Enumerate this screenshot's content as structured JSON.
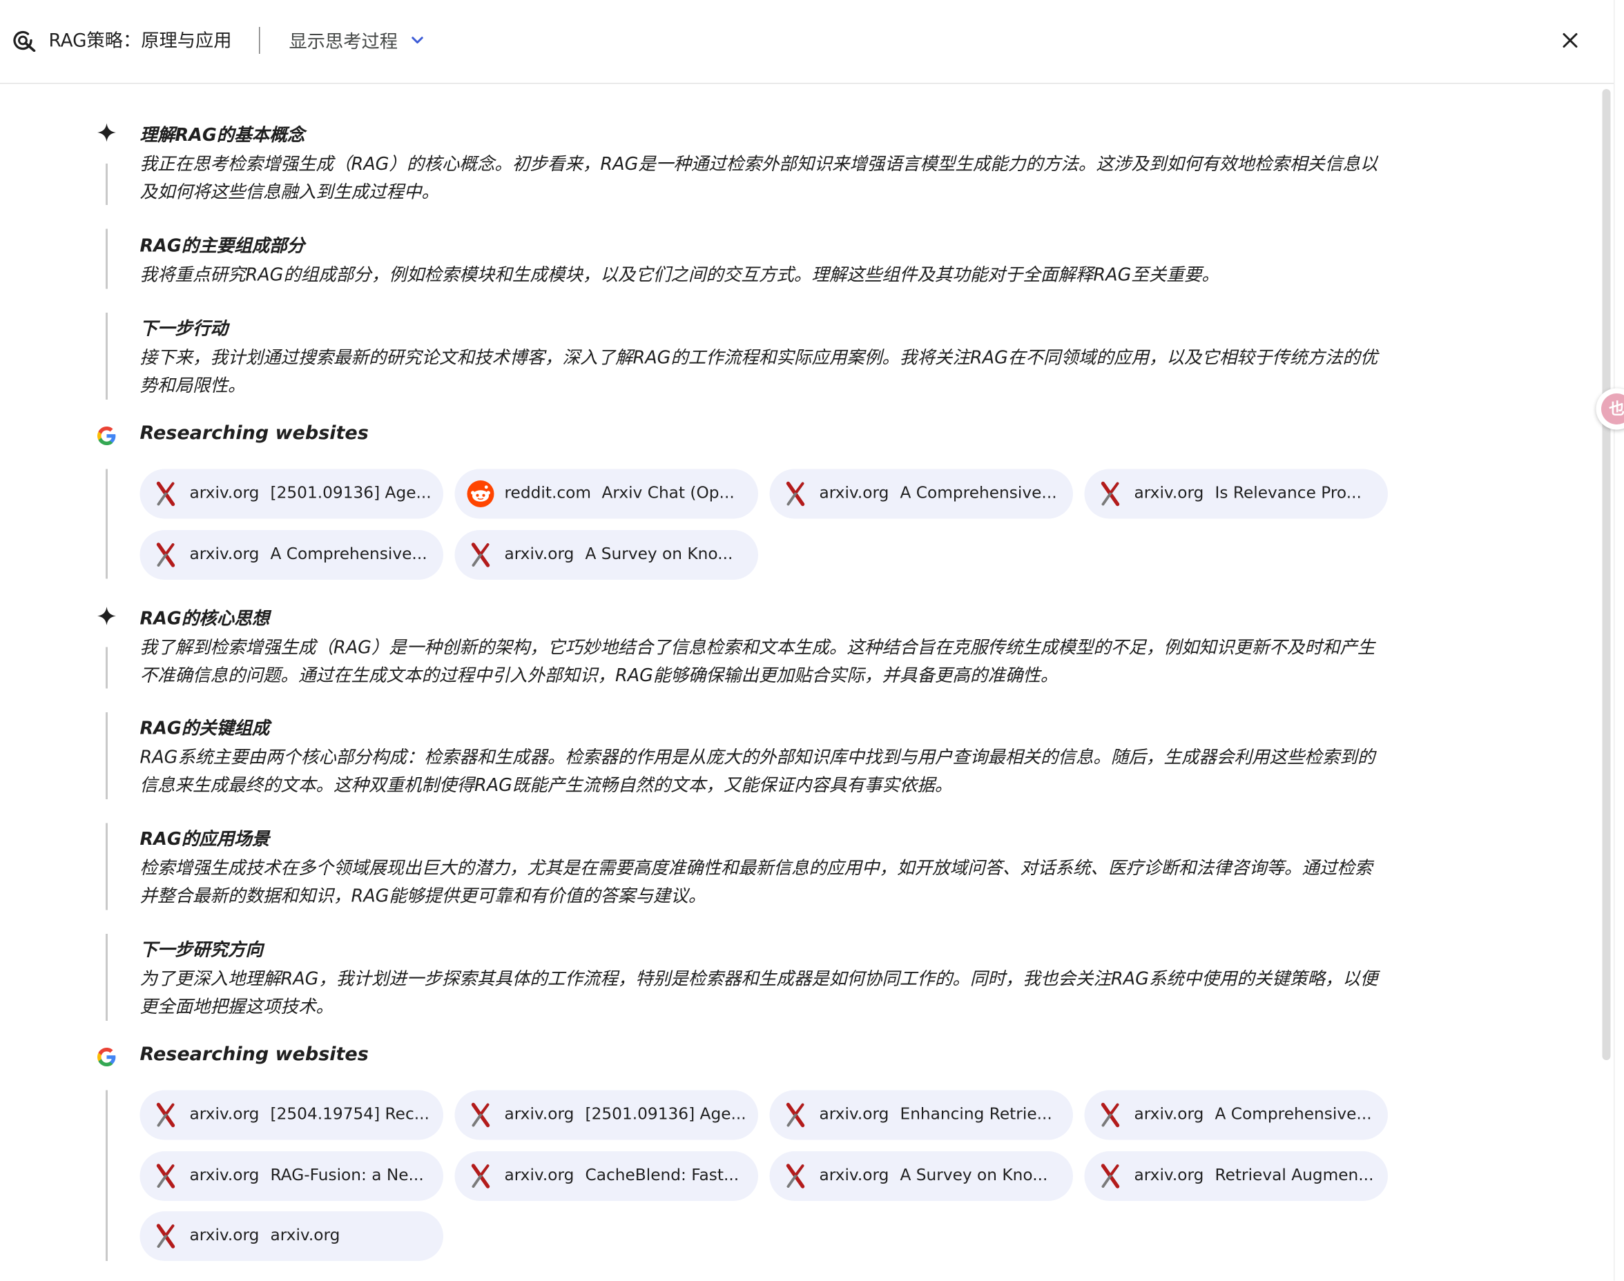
{
  "header": {
    "title": "RAG策略：原理与应用",
    "toggle_label": "显示思考过程"
  },
  "sections": [
    {
      "title": "理解RAG的基本概念",
      "lines": [
        "我正在思考检索增强生成（RAG）的核心概念。初步看来，RAG是一种通过检索外部知识来增强语言模型生成能力的方法。这涉及到如何有效地检索相关信息以",
        "及如何将这些信息融入到生成过程中。"
      ]
    },
    {
      "title": "RAG的主要组成部分",
      "lines": [
        "我将重点研究RAG的组成部分，例如检索模块和生成模块，以及它们之间的交互方式。理解这些组件及其功能对于全面解释RAG至关重要。"
      ]
    },
    {
      "title": "下一步行动",
      "lines": [
        "接下来，我计划通过搜索最新的研究论文和技术博客，深入了解RAG的工作流程和实际应用案例。我将关注RAG在不同领域的应用，以及它相较于传统方法的优",
        "势和局限性。"
      ]
    },
    {
      "title": "RAG的核心思想",
      "lines": [
        "我了解到检索增强生成（RAG）是一种创新的架构，它巧妙地结合了信息检索和文本生成。这种结合旨在克服传统生成模型的不足，例如知识更新不及时和产生",
        "不准确信息的问题。通过在生成文本的过程中引入外部知识，RAG能够确保输出更加贴合实际，并具备更高的准确性。"
      ]
    },
    {
      "title": "RAG的关键组成",
      "lines": [
        "RAG系统主要由两个核心部分构成：检索器和生成器。检索器的作用是从庞大的外部知识库中找到与用户查询最相关的信息。随后，生成器会利用这些检索到的",
        "信息来生成最终的文本。这种双重机制使得RAG既能产生流畅自然的文本，又能保证内容具有事实依据。"
      ]
    },
    {
      "title": "RAG的应用场景",
      "lines": [
        "检索增强生成技术在多个领域展现出巨大的潜力，尤其是在需要高度准确性和最新信息的应用中，如开放域问答、对话系统、医疗诊断和法律咨询等。通过检索",
        "并整合最新的数据和知识，RAG能够提供更可靠和有价值的答案与建议。"
      ]
    },
    {
      "title": "下一步研究方向",
      "lines": [
        "为了更深入地理解RAG，我计划进一步探索其具体的工作流程，特别是检索器和生成器是如何协同工作的。同时，我也会关注RAG系统中使用的关键策略，以便",
        "更全面地把握这项技术。"
      ]
    }
  ],
  "research": [
    {
      "title": "Researching websites",
      "chips": [
        {
          "domain": "arxiv.org",
          "title": "[2501.09136] Age...",
          "icon": "arxiv-icon"
        },
        {
          "domain": "reddit.com",
          "title": "Arxiv Chat (Op...",
          "icon": "reddit-icon"
        },
        {
          "domain": "arxiv.org",
          "title": "A Comprehensive...",
          "icon": "arxiv-icon"
        },
        {
          "domain": "arxiv.org",
          "title": "Is Relevance Pro...",
          "icon": "arxiv-icon"
        },
        {
          "domain": "arxiv.org",
          "title": "A Comprehensive...",
          "icon": "arxiv-icon"
        },
        {
          "domain": "arxiv.org",
          "title": "A Survey on Kno...",
          "icon": "arxiv-icon"
        }
      ]
    },
    {
      "title": "Researching websites",
      "chips": [
        {
          "domain": "arxiv.org",
          "title": "[2504.19754] Rec...",
          "icon": "arxiv-icon"
        },
        {
          "domain": "arxiv.org",
          "title": "[2501.09136] Age...",
          "icon": "arxiv-icon"
        },
        {
          "domain": "arxiv.org",
          "title": "Enhancing Retrie...",
          "icon": "arxiv-icon"
        },
        {
          "domain": "arxiv.org",
          "title": "A Comprehensive...",
          "icon": "arxiv-icon"
        },
        {
          "domain": "arxiv.org",
          "title": "RAG-Fusion: a Ne...",
          "icon": "arxiv-icon"
        },
        {
          "domain": "arxiv.org",
          "title": "CacheBlend: Fast...",
          "icon": "arxiv-icon"
        },
        {
          "domain": "arxiv.org",
          "title": "A Survey on Kno...",
          "icon": "arxiv-icon"
        },
        {
          "domain": "arxiv.org",
          "title": "Retrieval Augmen...",
          "icon": "arxiv-icon"
        },
        {
          "domain": "arxiv.org",
          "title": "arxiv.org",
          "icon": "arxiv-icon"
        }
      ]
    }
  ],
  "side_badge": "也",
  "colors": {
    "chip_bg": "#eff1fb",
    "accent": "#3c5bd6",
    "arxiv_red": "#b31b1b",
    "reddit_orange": "#ff4500"
  }
}
